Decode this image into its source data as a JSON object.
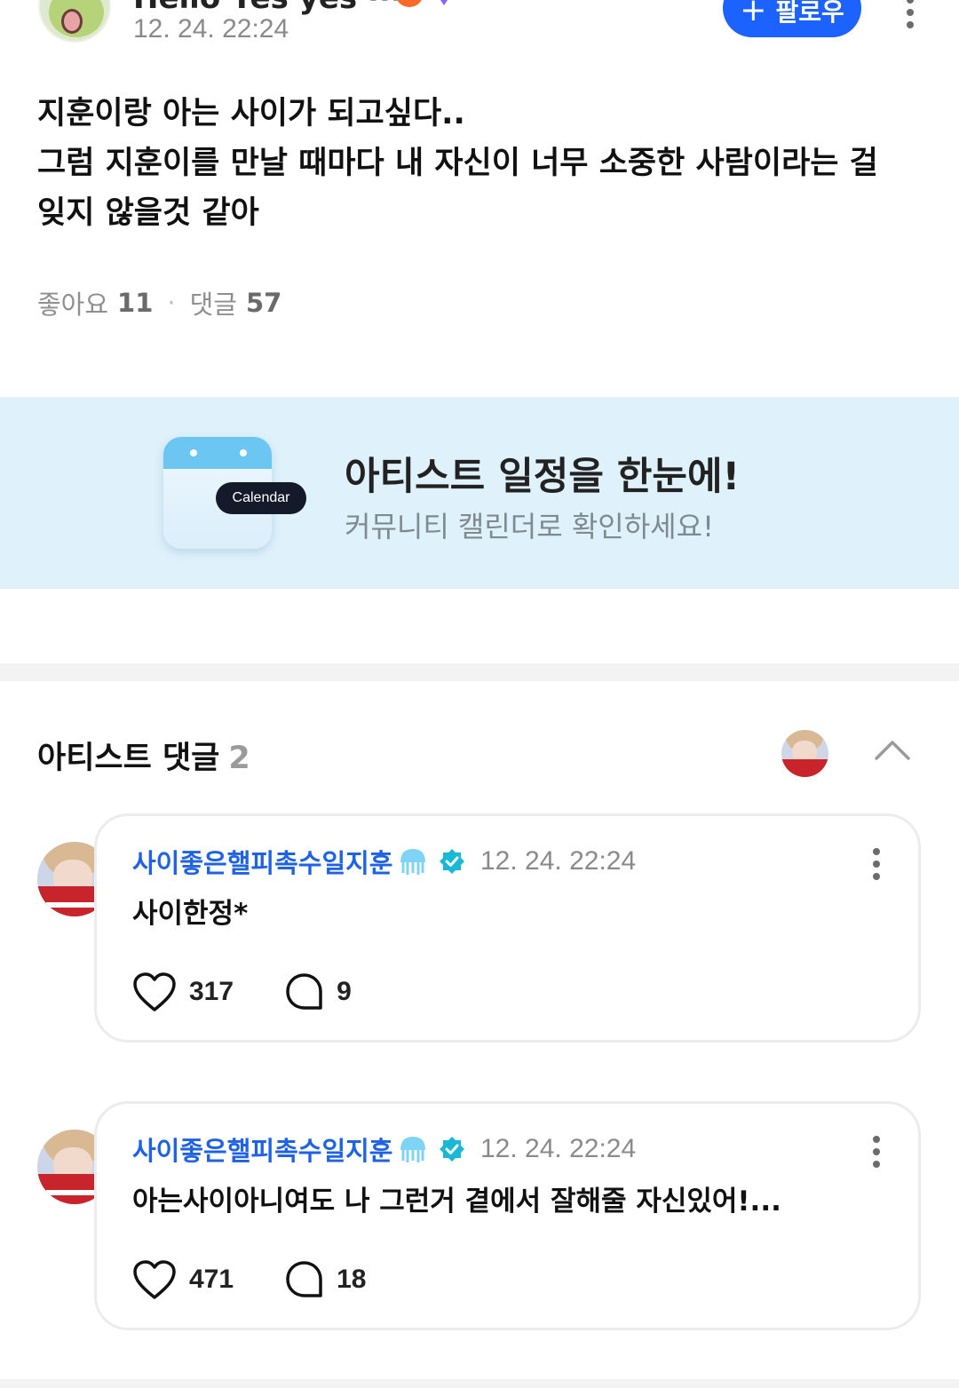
{
  "post": {
    "author_name": "Hello Yes yes ··· ",
    "time": "12. 24. 22:24",
    "follow_label": "팔로우",
    "body_lines": [
      "지훈이랑 아는 사이가 되고싶다..",
      "그럼 지훈이를 만날 때마다 내 자신이 너무 소중한 사람이라는 걸",
      "잊지 않을것 같아"
    ],
    "likes_label": "좋아요",
    "likes_count": "11",
    "comments_label": "댓글",
    "comments_count": "57"
  },
  "banner": {
    "title": "아티스트 일정을 한눈에!",
    "subtitle": "커뮤니티 캘린더로 확인하세요!",
    "pill_label": "Calendar",
    "bg_color": "#dff1fb"
  },
  "artist_comments": {
    "title": "아티스트 댓글",
    "count": "2",
    "items": [
      {
        "name": "사이좋은핼피촉수일지훈",
        "time": "12. 24. 22:24",
        "text": "사이한정*",
        "likes": "317",
        "replies": "9"
      },
      {
        "name": "사이좋은핼피촉수일지훈",
        "time": "12. 24. 22:24",
        "text": "아는사이아니여도 나 그런거 곁에서 잘해줄 자신있어!...",
        "likes": "471",
        "replies": "18"
      }
    ]
  },
  "colors": {
    "accent": "#1b62ff",
    "name_blue": "#1f62e6",
    "verified": "#19b8d6"
  }
}
